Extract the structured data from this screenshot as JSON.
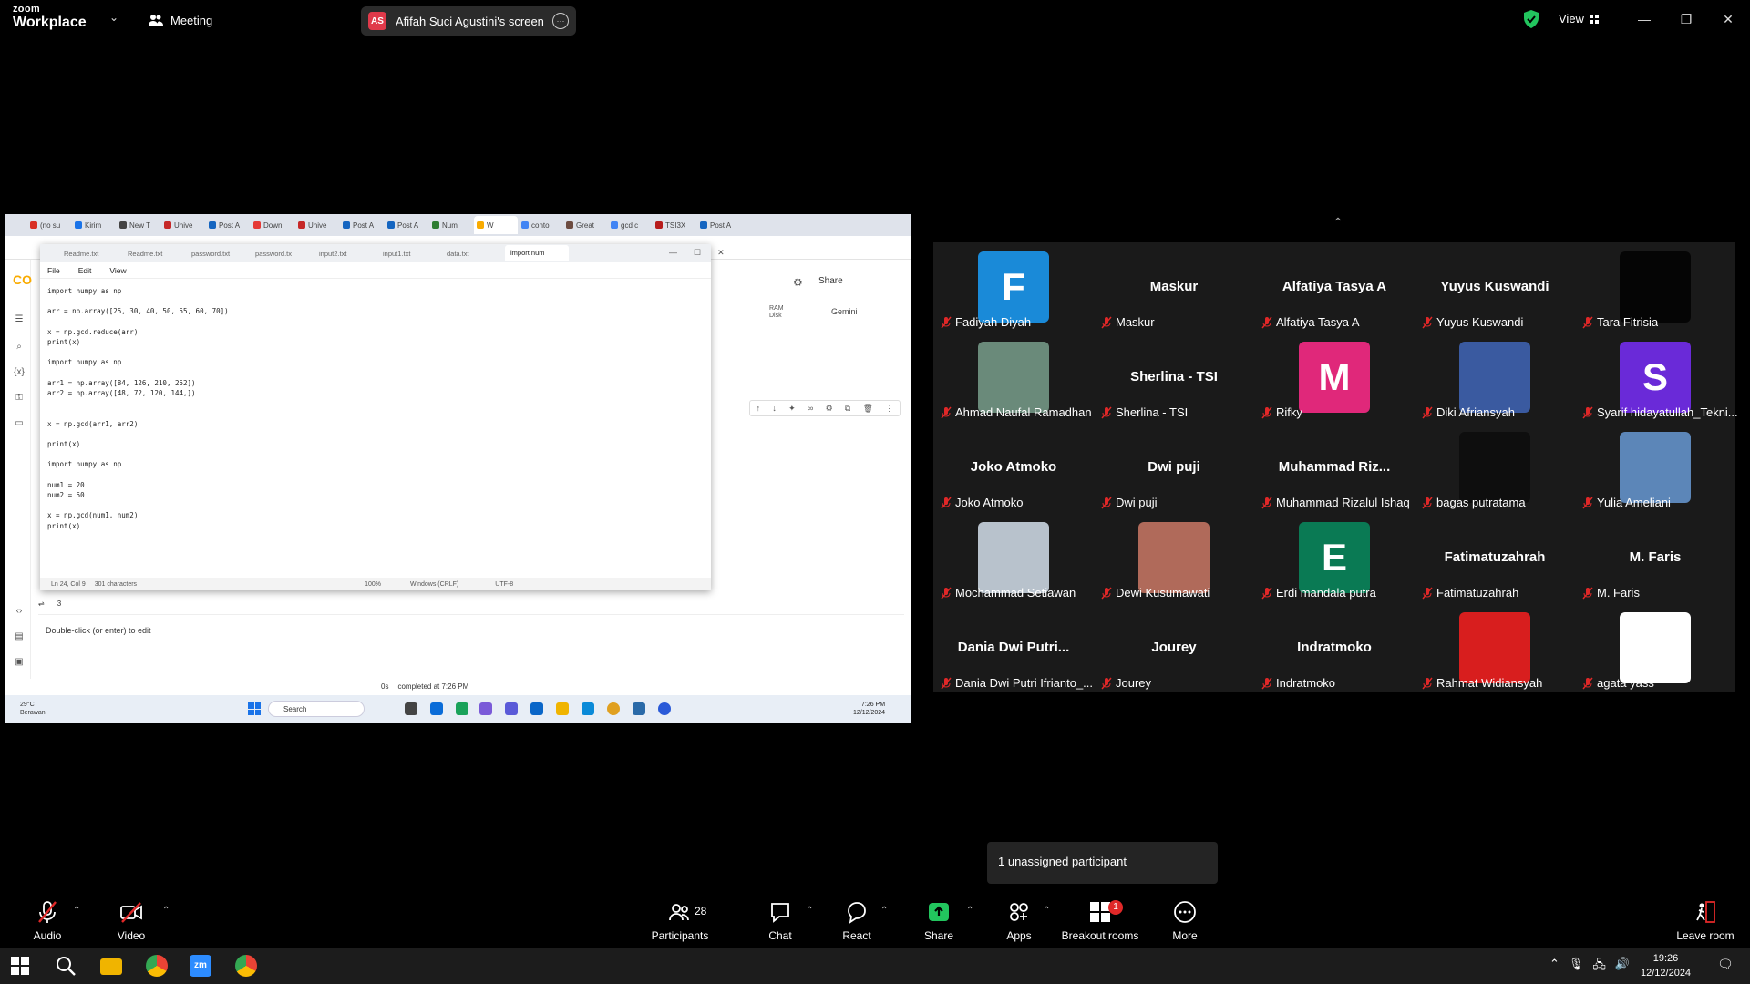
{
  "topbar": {
    "logo_line1": "zoom",
    "logo_line2": "Workplace",
    "meeting_label": "Meeting",
    "share_badge": "AS",
    "share_label": "Afifah Suci Agustini's screen",
    "view_label": "View",
    "more_glyph": "···"
  },
  "shared_screen": {
    "chrome_tabs": [
      "(no su",
      "Kirim",
      "New T",
      "Unive",
      "Post A",
      "Down",
      "Unive",
      "Post A",
      "Post A",
      "Num",
      "W",
      "conto",
      "Great",
      "gcd c",
      "TSI3X",
      "Post A"
    ],
    "colab": {
      "logo": "CO",
      "share_label": "Share",
      "ram_label": "RAM",
      "disk_label": "Disk",
      "gemini_label": "Gemini",
      "output_line": "3",
      "double_click": "Double-click (or enter) to edit",
      "run_time": "0s",
      "run_status": "completed at 7:26 PM"
    },
    "notepad": {
      "tabs": [
        "Readme.txt",
        "Readme.txt",
        "password.txt",
        "password.tx",
        "input2.txt",
        "input1.txt",
        "data.txt",
        "import num"
      ],
      "menu": [
        "File",
        "Edit",
        "View"
      ],
      "code": "import numpy as np\n\narr = np.array([25, 30, 40, 50, 55, 60, 70])\n\nx = np.gcd.reduce(arr)\nprint(x)\n\nimport numpy as np\n\narr1 = np.array([84, 126, 210, 252])\narr2 = np.array([48, 72, 120, 144,])\n\n\nx = np.gcd(arr1, arr2)\n\nprint(x)\n\nimport numpy as np\n\nnum1 = 20\nnum2 = 50\n\nx = np.gcd(num1, num2)\nprint(x)",
      "status_pos": "Ln 24, Col 9",
      "status_chars": "301 characters",
      "status_zoom": "100%",
      "status_eol": "Windows (CRLF)",
      "status_enc": "UTF-8"
    },
    "taskbar": {
      "weather_temp": "29°C",
      "weather_desc": "Berawan",
      "search": "Search",
      "time": "7:26 PM",
      "date": "12/12/2024"
    }
  },
  "gallery": {
    "participants": [
      {
        "name": "Fadiyah Diyah",
        "avatar": "F",
        "bg": "#1a8ad8"
      },
      {
        "name": "Maskur",
        "big": "Maskur"
      },
      {
        "name": "Alfatiya Tasya A",
        "big": "Alfatiya Tasya A"
      },
      {
        "name": "Yuyus Kuswandi",
        "big": "Yuyus Kuswandi"
      },
      {
        "name": "Tara Fitrisia",
        "avatar": "",
        "bg": "#050505"
      },
      {
        "name": "Ahmad Naufal Ramadhan",
        "avatar": "",
        "bg": "#6a8a7a"
      },
      {
        "name": "Sherlina - TSI",
        "big": "Sherlina - TSI"
      },
      {
        "name": "Rifky",
        "avatar": "M",
        "bg": "#e0287a"
      },
      {
        "name": "Diki Afriansyah",
        "avatar": "",
        "bg": "#3a5aa0"
      },
      {
        "name": "Syarif hidayatullah_Tekni...",
        "avatar": "S",
        "bg": "#6a2ad8"
      },
      {
        "name": "Joko Atmoko",
        "big": "Joko Atmoko"
      },
      {
        "name": "Dwi puji",
        "big": "Dwi puji"
      },
      {
        "name": "Muhammad Rizalul Ishaq",
        "big": "Muhammad  Riz..."
      },
      {
        "name": "bagas putratama",
        "avatar": "",
        "bg": "#0e0e0e"
      },
      {
        "name": "Yulia Ameliani",
        "avatar": "",
        "bg": "#5c86b8"
      },
      {
        "name": "Mochammad Setiawan",
        "avatar": "",
        "bg": "#b8c2cc"
      },
      {
        "name": "Dewi Kusumawati",
        "avatar": "",
        "bg": "#b06a5a"
      },
      {
        "name": "Erdi mandala putra",
        "avatar": "E",
        "bg": "#0a7a54"
      },
      {
        "name": "Fatimatuzahrah",
        "big": "Fatimatuzahrah"
      },
      {
        "name": "M. Faris",
        "big": "M. Faris"
      },
      {
        "name": "Dania Dwi Putri Ifrianto_...",
        "big": "Dania  Dwi  Putri..."
      },
      {
        "name": "Jourey",
        "big": "Jourey"
      },
      {
        "name": "Indratmoko",
        "big": "Indratmoko"
      },
      {
        "name": "Rahmat Widiansyah",
        "avatar": "",
        "bg": "#d81e1e"
      },
      {
        "name": "agata yass",
        "avatar": "",
        "bg": "#ffffff"
      }
    ]
  },
  "unassigned": "1 unassigned participant",
  "toolbar": {
    "audio": "Audio",
    "video": "Video",
    "participants": "Participants",
    "participants_count": "28",
    "chat": "Chat",
    "react": "React",
    "share": "Share",
    "apps": "Apps",
    "breakout": "Breakout rooms",
    "breakout_badge": "1",
    "more": "More",
    "leave": "Leave room"
  },
  "windows_taskbar": {
    "time": "19:26",
    "date": "12/12/2024"
  },
  "colors": {
    "zoom_red": "#e02828",
    "zoom_green": "#22c55e",
    "tile_bg": "#1a1a1a"
  }
}
